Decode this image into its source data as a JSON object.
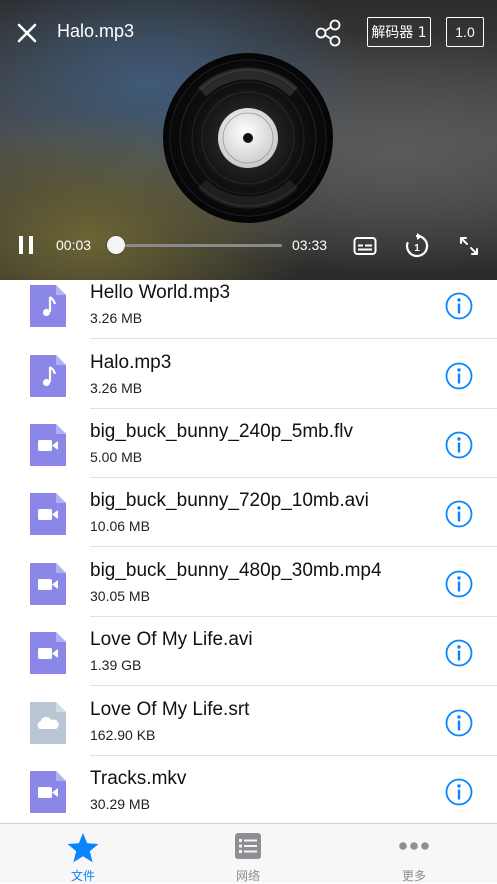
{
  "player": {
    "title": "Halo.mp3",
    "decoder_label": "解码器 1",
    "speed_label": "1.0",
    "current_time": "00:03",
    "total_time": "03:33",
    "progress_fraction": 0.014,
    "icons": {
      "close": "close-icon",
      "share": "share-icon",
      "pause": "pause-icon",
      "subtitle": "subtitle-icon",
      "replay": "replay-icon",
      "fullscreen": "fullscreen-icon"
    }
  },
  "files": [
    {
      "name": "Hello World.mp3",
      "size": "3.26 MB",
      "type": "audio"
    },
    {
      "name": "Halo.mp3",
      "size": "3.26 MB",
      "type": "audio"
    },
    {
      "name": "big_buck_bunny_240p_5mb.flv",
      "size": "5.00 MB",
      "type": "video"
    },
    {
      "name": "big_buck_bunny_720p_10mb.avi",
      "size": "10.06 MB",
      "type": "video"
    },
    {
      "name": "big_buck_bunny_480p_30mb.mp4",
      "size": "30.05 MB",
      "type": "video"
    },
    {
      "name": "Love Of My Life.avi",
      "size": "1.39 GB",
      "type": "video"
    },
    {
      "name": "Love Of My Life.srt",
      "size": "162.90 KB",
      "type": "subtitle"
    },
    {
      "name": "Tracks.mkv",
      "size": "30.29 MB",
      "type": "video"
    }
  ],
  "tabs": [
    {
      "label": "文件",
      "icon": "star-icon",
      "active": true
    },
    {
      "label": "网络",
      "icon": "list-icon",
      "active": false
    },
    {
      "label": "更多",
      "icon": "more-icon",
      "active": false
    }
  ],
  "colors": {
    "accent": "#0a84ff",
    "file_icon_purple": "#8a87e8",
    "file_icon_gray": "#b9c5d3",
    "tab_inactive": "#8e8e93"
  }
}
